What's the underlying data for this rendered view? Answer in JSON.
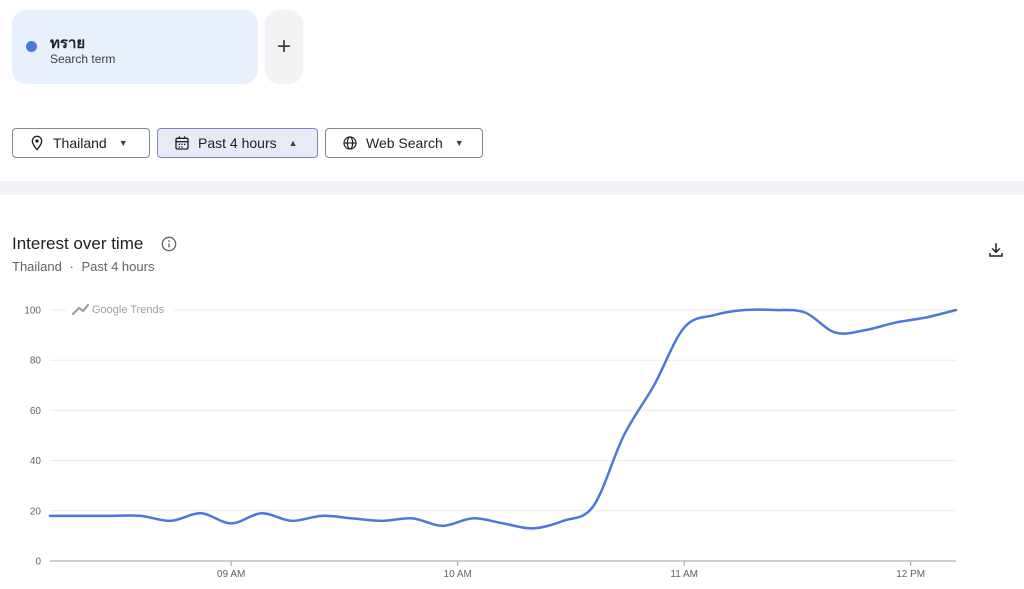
{
  "search_term": {
    "name": "ทราย",
    "subtitle": "Search term",
    "color": "#4a78db"
  },
  "add_button": {
    "label": "+"
  },
  "filters": {
    "region": "Thailand",
    "time": "Past 4 hours",
    "property": "Web Search"
  },
  "section": {
    "title": "Interest over time",
    "subtitle_region": "Thailand",
    "subtitle_sep": "·",
    "subtitle_time": "Past 4 hours"
  },
  "icons": {
    "location": "location-pin-icon",
    "calendar": "calendar-icon",
    "globe": "globe-icon",
    "info": "info-icon",
    "download": "download-icon",
    "trends_logo": "google-trends-icon"
  },
  "chart_data": {
    "type": "line",
    "watermark": "Google Trends",
    "ylim": [
      0,
      100
    ],
    "yticks": [
      0,
      20,
      40,
      60,
      80,
      100
    ],
    "xlim": [
      0,
      240
    ],
    "xticks": [
      {
        "value": 48,
        "label": "09 AM"
      },
      {
        "value": 108,
        "label": "10 AM"
      },
      {
        "value": 168,
        "label": "11 AM"
      },
      {
        "value": 228,
        "label": "12 PM"
      }
    ],
    "grid": true,
    "series": [
      {
        "color": "#4a78db",
        "x": [
          0,
          8,
          16,
          24,
          32,
          40,
          48,
          56,
          64,
          72,
          80,
          88,
          96,
          104,
          112,
          120,
          128,
          136,
          144,
          152,
          160,
          168,
          176,
          184,
          192,
          200,
          208,
          216,
          224,
          232,
          240
        ],
        "values": [
          18,
          18,
          18,
          18,
          16,
          19,
          15,
          19,
          16,
          18,
          17,
          16,
          17,
          14,
          17,
          15,
          13,
          16,
          22,
          50,
          70,
          93,
          98,
          100,
          100,
          99,
          91,
          92,
          95,
          97,
          100
        ]
      }
    ]
  }
}
